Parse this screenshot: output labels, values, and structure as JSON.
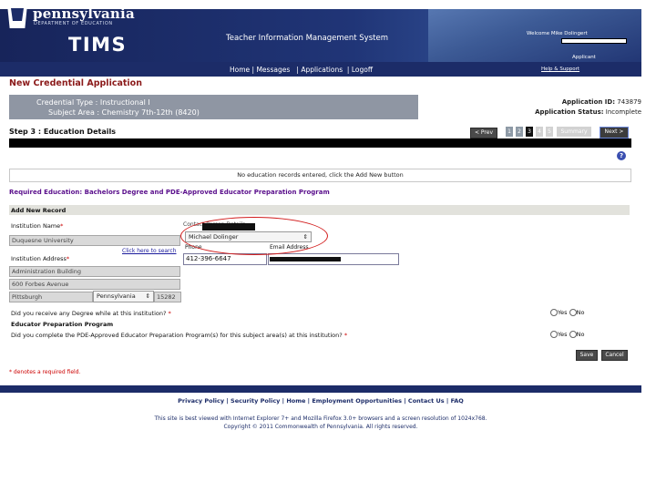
{
  "header": {
    "brand": "pennsylvania",
    "department": "DEPARTMENT OF EDUCATION",
    "app_short": "TIMS",
    "system_title": "Teacher Information Management System",
    "welcome": "Welcome Mike Dolingert",
    "role": "Applicant",
    "help_link": "Help & Support",
    "nav": [
      "Home",
      "Messages",
      "Applications",
      "Logoff"
    ]
  },
  "page": {
    "title": "New Credential Application",
    "credential_type": "Credential Type : Instructional I",
    "subject_area": "Subject Area : Chemistry 7th-12th (8420)",
    "app_id_label": "Application ID:",
    "app_id_value": "743879",
    "app_status_label": "Application Status:",
    "app_status_value": "Incomplete",
    "step_title": "Step 3 : Education Details"
  },
  "stepper": {
    "prev_label": "< Prev",
    "next_label": "Next >",
    "steps": [
      "1",
      "2",
      "3",
      "4",
      "5"
    ],
    "summary_label": "Summary",
    "current_step": 3
  },
  "records": {
    "empty_message": "No education records entered, click the Add New button"
  },
  "required_education": "Required Education: Bachelors Degree and PDE-Approved Educator Preparation Program",
  "form": {
    "section_title": "Add New Record",
    "institution_name_label": "Institution Name",
    "institution_name_value": "Duquesne University",
    "search_link": "Click here to search",
    "institution_address_label": "Institution Address",
    "address_line1": "Administration Building",
    "address_line2": "600 Forbes Avenue",
    "city": "Pittsburgh",
    "state": "Pennsylvania",
    "zip": "15282",
    "contact_label": "Contact Person Details",
    "contact_value": "Michael Dolinger",
    "phone_label": "Phone",
    "phone_value": "412-396-6647",
    "email_label": "Email Address",
    "degree_question": "Did you receive any Degree while at this institution?",
    "prep_title": "Educator Preparation Program",
    "prep_question": "Did you complete the PDE-Approved Educator Preparation Program(s) for this subject area(s) at this institution?",
    "yes_label": "Yes",
    "no_label": "No",
    "required_star": "*",
    "save_label": "Save",
    "cancel_label": "Cancel",
    "required_note": "* denotes a required field."
  },
  "footer": {
    "links": [
      "Privacy Policy",
      "Security Policy",
      "Home",
      "Employment Opportunities",
      "Contact Us",
      "FAQ"
    ],
    "browser_note": "This site is best viewed with Internet Explorer 7+ and Mozilla Firefox 3.0+ browsers and a screen resolution of 1024x768.",
    "copyright": "Copyright © 2011 Commonwealth of Pennsylvania. All rights reserved."
  },
  "colors": {
    "header_navy": "#1c2c68",
    "title_red": "#8b1a1a",
    "section_purple": "#5a0f8c",
    "credential_gray": "#8f96a3",
    "highlight_red": "#d21c1c"
  }
}
